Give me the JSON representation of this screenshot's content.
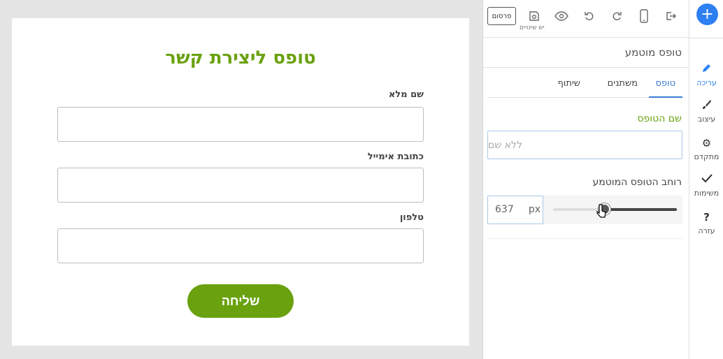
{
  "form": {
    "title": "טופס ליצירת קשר",
    "fields": [
      {
        "label": "שם מלא",
        "value": ""
      },
      {
        "label": "כתובת אימייל",
        "value": ""
      },
      {
        "label": "טלפון",
        "value": ""
      }
    ],
    "submit_label": "שליחה",
    "accent_color": "#6aa10f"
  },
  "toolbar": {
    "publish_label": "פרסום",
    "changes_label": "יש שינויים",
    "icons": [
      "exit-icon",
      "mobile-icon",
      "redo-icon",
      "undo-icon",
      "preview-eye-icon",
      "save-icon"
    ]
  },
  "panel": {
    "title": "טופס מוטמע",
    "tabs": [
      {
        "label": "טופס",
        "active": true
      },
      {
        "label": "משתנים",
        "active": false
      },
      {
        "label": "שיתוף",
        "active": false
      }
    ],
    "form_name_label": "שם הטופס",
    "form_name_placeholder": "ללא שם",
    "width_label": "רוחב הטופס המוטמע",
    "width_value": "637",
    "width_unit": "px",
    "width_fraction": 0.41
  },
  "rail": {
    "items": [
      {
        "label": "עריכה",
        "icon": "pencil-icon",
        "active": true
      },
      {
        "label": "עיצוב",
        "icon": "brush-icon",
        "active": false
      },
      {
        "label": "מתקדם",
        "icon": "gear-icon",
        "active": false
      },
      {
        "label": "משימות",
        "icon": "check-icon",
        "active": false
      },
      {
        "label": "עזרה",
        "icon": "help-icon",
        "active": false
      }
    ],
    "accent_color": "#2e80f2"
  }
}
